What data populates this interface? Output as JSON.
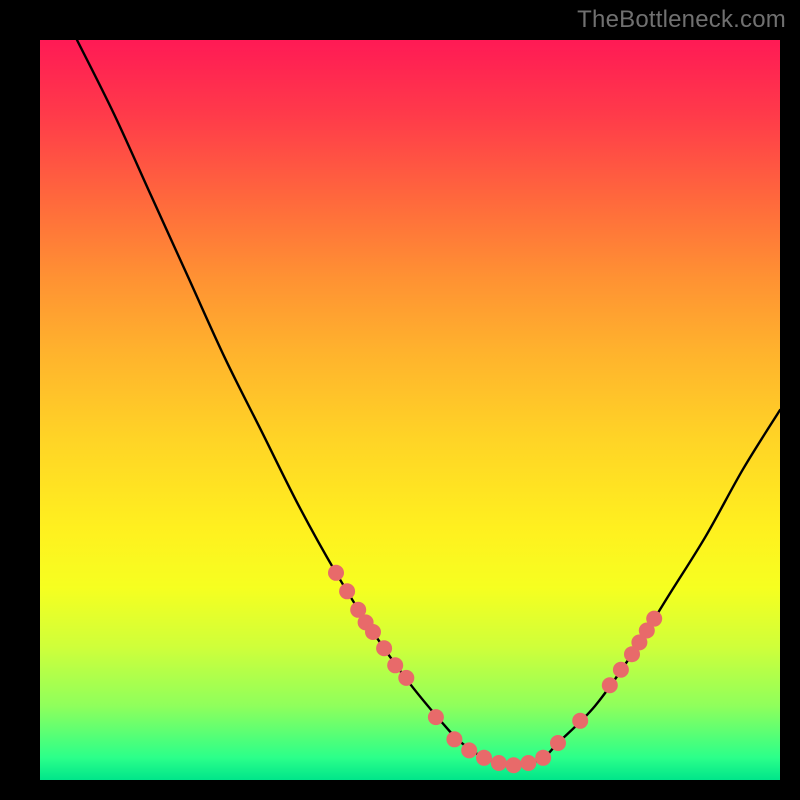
{
  "attribution": "TheBottleneck.com",
  "colors": {
    "background": "#000000",
    "gradient_top": "#ff1a55",
    "gradient_bottom": "#00e58a",
    "curve": "#000000",
    "markers": "#e86a6a"
  },
  "chart_data": {
    "type": "line",
    "title": "",
    "xlabel": "",
    "ylabel": "",
    "xlim": [
      0,
      100
    ],
    "ylim": [
      0,
      100
    ],
    "series": [
      {
        "name": "bottleneck-curve",
        "x": [
          5,
          10,
          15,
          20,
          25,
          30,
          35,
          40,
          45,
          50,
          55,
          57,
          60,
          63,
          65,
          68,
          70,
          75,
          80,
          85,
          90,
          95,
          100
        ],
        "y": [
          100,
          90,
          79,
          68,
          57,
          47,
          37,
          28,
          20,
          13,
          7,
          5,
          3,
          2,
          2,
          3,
          5,
          10,
          17,
          25,
          33,
          42,
          50
        ]
      }
    ],
    "markers": [
      {
        "cluster": "left",
        "x": 40.0,
        "y": 28.0
      },
      {
        "cluster": "left",
        "x": 41.5,
        "y": 25.5
      },
      {
        "cluster": "left",
        "x": 43.0,
        "y": 23.0
      },
      {
        "cluster": "left",
        "x": 44.0,
        "y": 21.3
      },
      {
        "cluster": "left",
        "x": 45.0,
        "y": 20.0
      },
      {
        "cluster": "left",
        "x": 46.5,
        "y": 17.8
      },
      {
        "cluster": "left",
        "x": 48.0,
        "y": 15.5
      },
      {
        "cluster": "left",
        "x": 49.5,
        "y": 13.8
      },
      {
        "cluster": "bottom",
        "x": 53.5,
        "y": 8.5
      },
      {
        "cluster": "bottom",
        "x": 56.0,
        "y": 5.5
      },
      {
        "cluster": "bottom",
        "x": 58.0,
        "y": 4.0
      },
      {
        "cluster": "bottom",
        "x": 60.0,
        "y": 3.0
      },
      {
        "cluster": "bottom",
        "x": 62.0,
        "y": 2.3
      },
      {
        "cluster": "bottom",
        "x": 64.0,
        "y": 2.0
      },
      {
        "cluster": "bottom",
        "x": 66.0,
        "y": 2.3
      },
      {
        "cluster": "bottom",
        "x": 68.0,
        "y": 3.0
      },
      {
        "cluster": "bottom",
        "x": 70.0,
        "y": 5.0
      },
      {
        "cluster": "right",
        "x": 73.0,
        "y": 8.0
      },
      {
        "cluster": "right",
        "x": 77.0,
        "y": 12.8
      },
      {
        "cluster": "right",
        "x": 78.5,
        "y": 14.9
      },
      {
        "cluster": "right",
        "x": 80.0,
        "y": 17.0
      },
      {
        "cluster": "right",
        "x": 81.0,
        "y": 18.6
      },
      {
        "cluster": "right",
        "x": 82.0,
        "y": 20.2
      },
      {
        "cluster": "right",
        "x": 83.0,
        "y": 21.8
      }
    ]
  }
}
